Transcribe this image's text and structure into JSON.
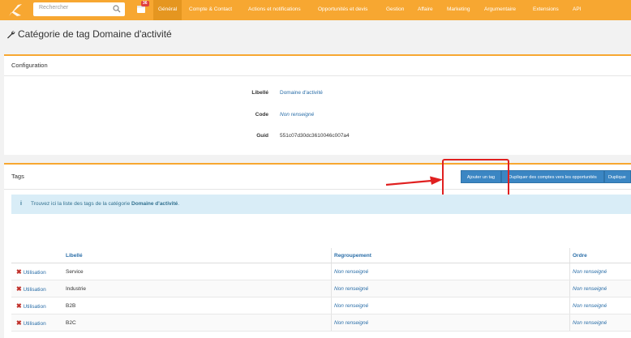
{
  "topbar": {
    "search_placeholder": "Rechercher",
    "notification_count": "36",
    "nav": [
      "Général",
      "Compte & Contact",
      "Actions et notifications",
      "Opportunités et devis",
      "Gestion",
      "Affaire",
      "Marketing",
      "Argumentaire",
      "Extensions",
      "API"
    ],
    "active_nav": "Général"
  },
  "page": {
    "title": "Catégorie de tag Domaine d'activité"
  },
  "config": {
    "header": "Configuration",
    "fields": [
      {
        "label": "Libellé",
        "value": "Domaine d'activité"
      },
      {
        "label": "Code",
        "value": "Non renseigné"
      },
      {
        "label": "Guid",
        "value": "551c07d30dc3610046c007a4"
      }
    ]
  },
  "tags_panel": {
    "header": "Tags",
    "buttons": [
      "Ajouter un tag",
      "Dupliquer des comptes vers les opportunités",
      "Duplique"
    ],
    "info_prefix": "Trouvez ici la liste des tags de la catégorie ",
    "info_category": "Domaine d'activité",
    "info_suffix": ".",
    "columns": [
      "Libellé",
      "Regroupement",
      "Ordre"
    ],
    "rows": [
      {
        "usage": "Utilisation",
        "label": "Service",
        "group": "Non renseigné",
        "order": "Non renseigné"
      },
      {
        "usage": "Utilisation",
        "label": "Industrie",
        "group": "Non renseigné",
        "order": "Non renseigné"
      },
      {
        "usage": "Utilisation",
        "label": "B2B",
        "group": "Non renseigné",
        "order": "Non renseigné"
      },
      {
        "usage": "Utilisation",
        "label": "B2C",
        "group": "Non renseigné",
        "order": "Non renseigné"
      }
    ]
  },
  "icons": {
    "logo": "k-logo-icon",
    "search": "search-icon",
    "calendar": "calendar-icon",
    "wrench": "wrench-icon",
    "info": "info-icon",
    "delete": "delete-x-icon"
  },
  "colors": {
    "brand": "#f7a731",
    "button": "#3b86c3",
    "link": "#2a6ea8",
    "info_bg": "#d9edf7",
    "annotation": "#e02020"
  }
}
